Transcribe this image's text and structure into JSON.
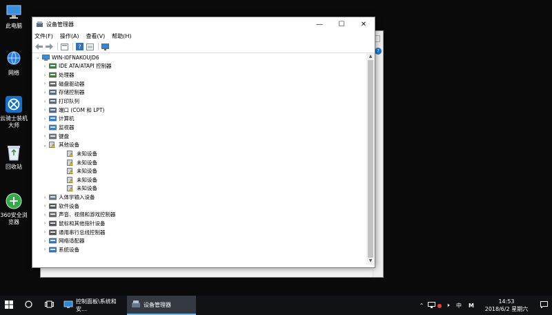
{
  "desktop": {
    "icons": [
      {
        "label": "此电脑",
        "icon": "computer-icon"
      },
      {
        "label": "网络",
        "icon": "network-icon"
      },
      {
        "label": "云骑士装机大师",
        "icon": "knight-icon"
      },
      {
        "label": "回收站",
        "icon": "recycle-bin-icon"
      },
      {
        "label": "360安全浏览器",
        "icon": "browser-icon"
      }
    ]
  },
  "window": {
    "title": "设备管理器",
    "buttons": {
      "minimize": "—",
      "maximize": "☐",
      "close": "✕"
    },
    "menu": [
      "文件(F)",
      "操作(A)",
      "查看(V)",
      "帮助(H)"
    ],
    "tree": {
      "root": "WIN-I0FNAKOUJD6",
      "items": [
        {
          "label": "IDE ATA/ATAPI 控制器",
          "icon": "ide-icon",
          "level": 1,
          "expander": "collapsed"
        },
        {
          "label": "处理器",
          "icon": "cpu-icon",
          "level": 1,
          "expander": "collapsed"
        },
        {
          "label": "磁盘驱动器",
          "icon": "disk-icon",
          "level": 1,
          "expander": "collapsed"
        },
        {
          "label": "存储控制器",
          "icon": "storage-icon",
          "level": 1,
          "expander": "collapsed"
        },
        {
          "label": "打印队列",
          "icon": "printer-icon",
          "level": 1,
          "expander": "collapsed"
        },
        {
          "label": "端口 (COM 和 LPT)",
          "icon": "port-icon",
          "level": 1,
          "expander": "collapsed"
        },
        {
          "label": "计算机",
          "icon": "monitor-icon",
          "level": 1,
          "expander": "collapsed"
        },
        {
          "label": "监视器",
          "icon": "monitor-icon",
          "level": 1,
          "expander": "collapsed"
        },
        {
          "label": "键盘",
          "icon": "keyboard-icon",
          "level": 1,
          "expander": "collapsed"
        },
        {
          "label": "其他设备",
          "icon": "warning-device-icon",
          "level": 1,
          "expander": "expanded"
        },
        {
          "label": "未知设备",
          "icon": "warning-device-icon",
          "level": 2,
          "expander": "none"
        },
        {
          "label": "未知设备",
          "icon": "warning-device-icon",
          "level": 2,
          "expander": "none"
        },
        {
          "label": "未知设备",
          "icon": "warning-device-icon",
          "level": 2,
          "expander": "none"
        },
        {
          "label": "未知设备",
          "icon": "warning-device-icon",
          "level": 2,
          "expander": "none"
        },
        {
          "label": "未知设备",
          "icon": "warning-device-icon",
          "level": 2,
          "expander": "none"
        },
        {
          "label": "人体学输入设备",
          "icon": "hid-icon",
          "level": 1,
          "expander": "collapsed"
        },
        {
          "label": "软件设备",
          "icon": "software-device-icon",
          "level": 1,
          "expander": "collapsed"
        },
        {
          "label": "声音、视频和游戏控制器",
          "icon": "sound-icon",
          "level": 1,
          "expander": "collapsed"
        },
        {
          "label": "鼠标和其他指针设备",
          "icon": "mouse-icon",
          "level": 1,
          "expander": "collapsed"
        },
        {
          "label": "通用串行总线控制器",
          "icon": "usb-icon",
          "level": 1,
          "expander": "collapsed"
        },
        {
          "label": "网络适配器",
          "icon": "network-adapter-icon",
          "level": 1,
          "expander": "collapsed"
        },
        {
          "label": "系统设备",
          "icon": "system-device-icon",
          "level": 1,
          "expander": "collapsed"
        }
      ]
    }
  },
  "taskbar": {
    "tasks": [
      {
        "label": "控制面板\\系统和安...",
        "icon": "control-panel-icon"
      },
      {
        "label": "设备管理器",
        "icon": "device-manager-icon"
      }
    ],
    "tray": {
      "ime": "中",
      "ime_mode": "M",
      "time": "14:53",
      "date": "2018/6/2 星期六"
    }
  },
  "colors": {
    "taskbar": "#101216",
    "desktop": "#0a0a0a",
    "accent": "#0078d7"
  }
}
